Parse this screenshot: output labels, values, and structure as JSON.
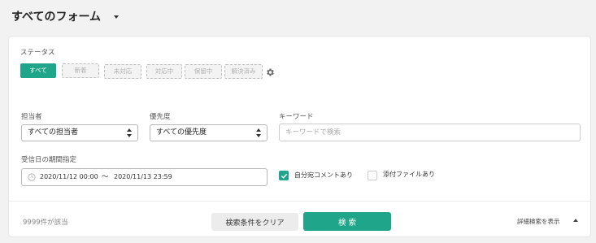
{
  "header": {
    "title": "すべてのフォーム"
  },
  "status": {
    "label": "ステータス",
    "chips": [
      "すべて",
      "新着",
      "未対応",
      "対応中",
      "保留中",
      "解決済み"
    ]
  },
  "assignee": {
    "label": "担当者",
    "value": "すべての担当者"
  },
  "priority": {
    "label": "優先度",
    "value": "すべての優先度"
  },
  "keyword": {
    "label": "キーワード",
    "placeholder": "キーワードで検索"
  },
  "date_range": {
    "label": "受信日の期間指定",
    "start": "2020/11/12 00:00",
    "separator": "〜",
    "end": "2020/11/13 23:59"
  },
  "options": {
    "own_comment": {
      "label": "自分宛コメントあり",
      "checked": true
    },
    "attachment": {
      "label": "添付ファイルあり",
      "checked": false
    }
  },
  "footer": {
    "count": "9999件が該当",
    "clear_label": "検索条件をクリア",
    "search_label": "検 索",
    "detail_label": "詳細検索を表示"
  },
  "colors": {
    "accent": "#1fa58a"
  }
}
